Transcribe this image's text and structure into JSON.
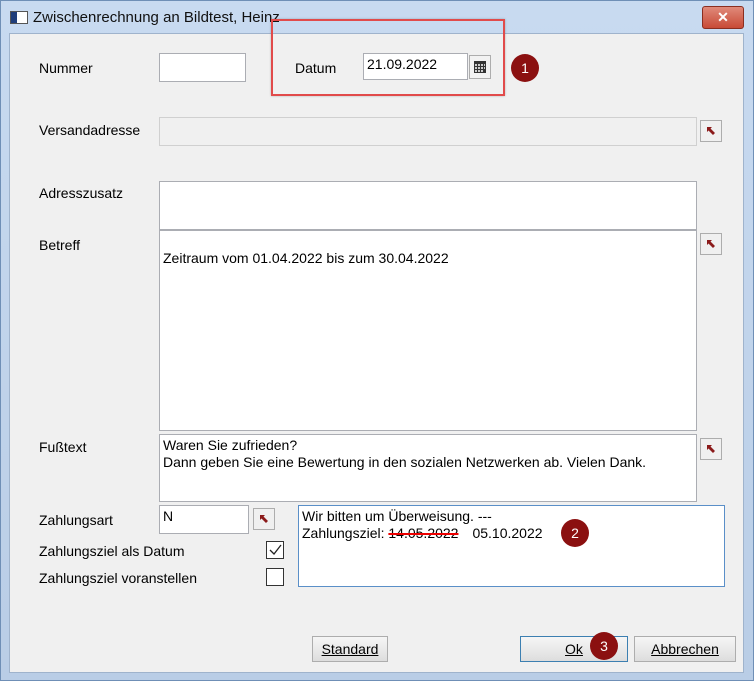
{
  "window": {
    "title": "Zwischenrechnung an Bildtest, Heinz",
    "close_label": "✕"
  },
  "form": {
    "nummer": {
      "label": "Nummer",
      "value": ""
    },
    "datum": {
      "label": "Datum",
      "value": "21.09.2022"
    },
    "versandadresse": {
      "label": "Versandadresse",
      "value": ""
    },
    "adresszusatz": {
      "label": "Adresszusatz",
      "value": ""
    },
    "betreff": {
      "label": "Betreff",
      "value": "Zeitraum vom 01.04.2022 bis zum 30.04.2022"
    },
    "fusstext": {
      "label": "Fußtext",
      "value": "Waren Sie zufrieden?\nDann geben Sie eine Bewertung in den sozialen Netzwerken ab. Vielen Dank."
    },
    "zahlungsart": {
      "label": "Zahlungsart",
      "value": "N"
    },
    "zahlungsziel_datum": {
      "label": "Zahlungsziel als Datum",
      "checked": true
    },
    "zahlungsziel_voranstellen": {
      "label": "Zahlungsziel voranstellen",
      "checked": false
    },
    "zahlungstext": {
      "line1": "Wir bitten um Überweisung. ---",
      "prefix": "Zahlungsziel: ",
      "old_date": "14.05.2022",
      "new_date": "05.10.2022"
    }
  },
  "buttons": {
    "standard": "Standard",
    "ok": "Ok",
    "abbrechen": "Abbrechen"
  },
  "badges": [
    "1",
    "2",
    "3"
  ],
  "colors": {
    "badge": "#8b1010",
    "highlight": "#e14b4b",
    "arrow": "#8b1a1a"
  }
}
